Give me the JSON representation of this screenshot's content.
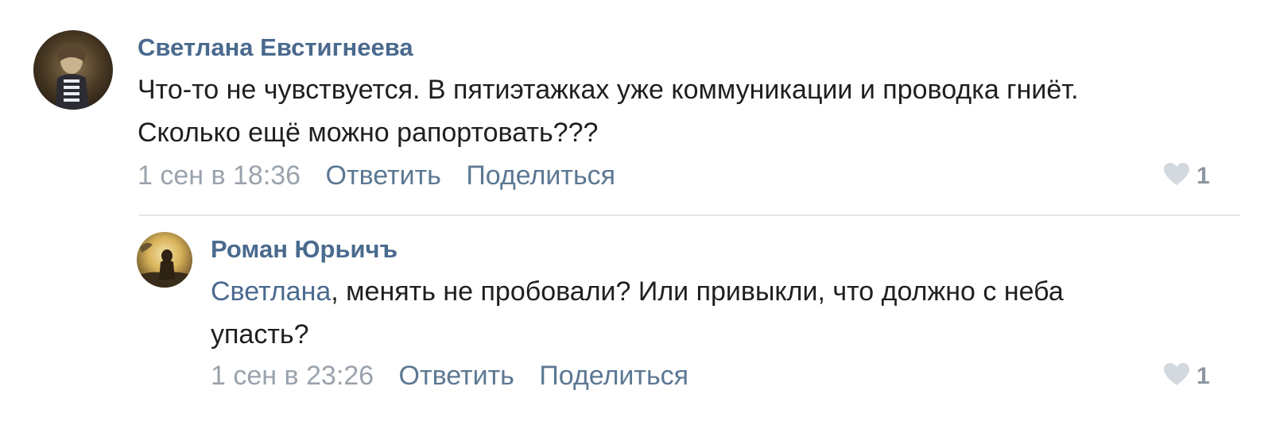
{
  "comments": [
    {
      "author": "Светлана Евстигнеева",
      "text_line1": "Что-то не чувствуется. В пятиэтажках уже коммуникации и проводка гниёт.",
      "text_line2": "Сколько ещё можно рапортовать???",
      "date": "1 сен в 18:36",
      "reply_label": "Ответить",
      "share_label": "Поделиться",
      "likes": "1"
    },
    {
      "author": "Роман Юрьичъ",
      "mention": "Светлана",
      "text_line1_rest": ", менять не пробовали? Или привыкли, что должно с неба",
      "text_line2": "упасть?",
      "date": "1 сен в 23:26",
      "reply_label": "Ответить",
      "share_label": "Поделиться",
      "likes": "1"
    }
  ],
  "colors": {
    "link": "#4a6a8e",
    "meta": "#9aa3ad",
    "heart": "#d4d9df"
  },
  "icons": {
    "like": "heart-icon"
  }
}
